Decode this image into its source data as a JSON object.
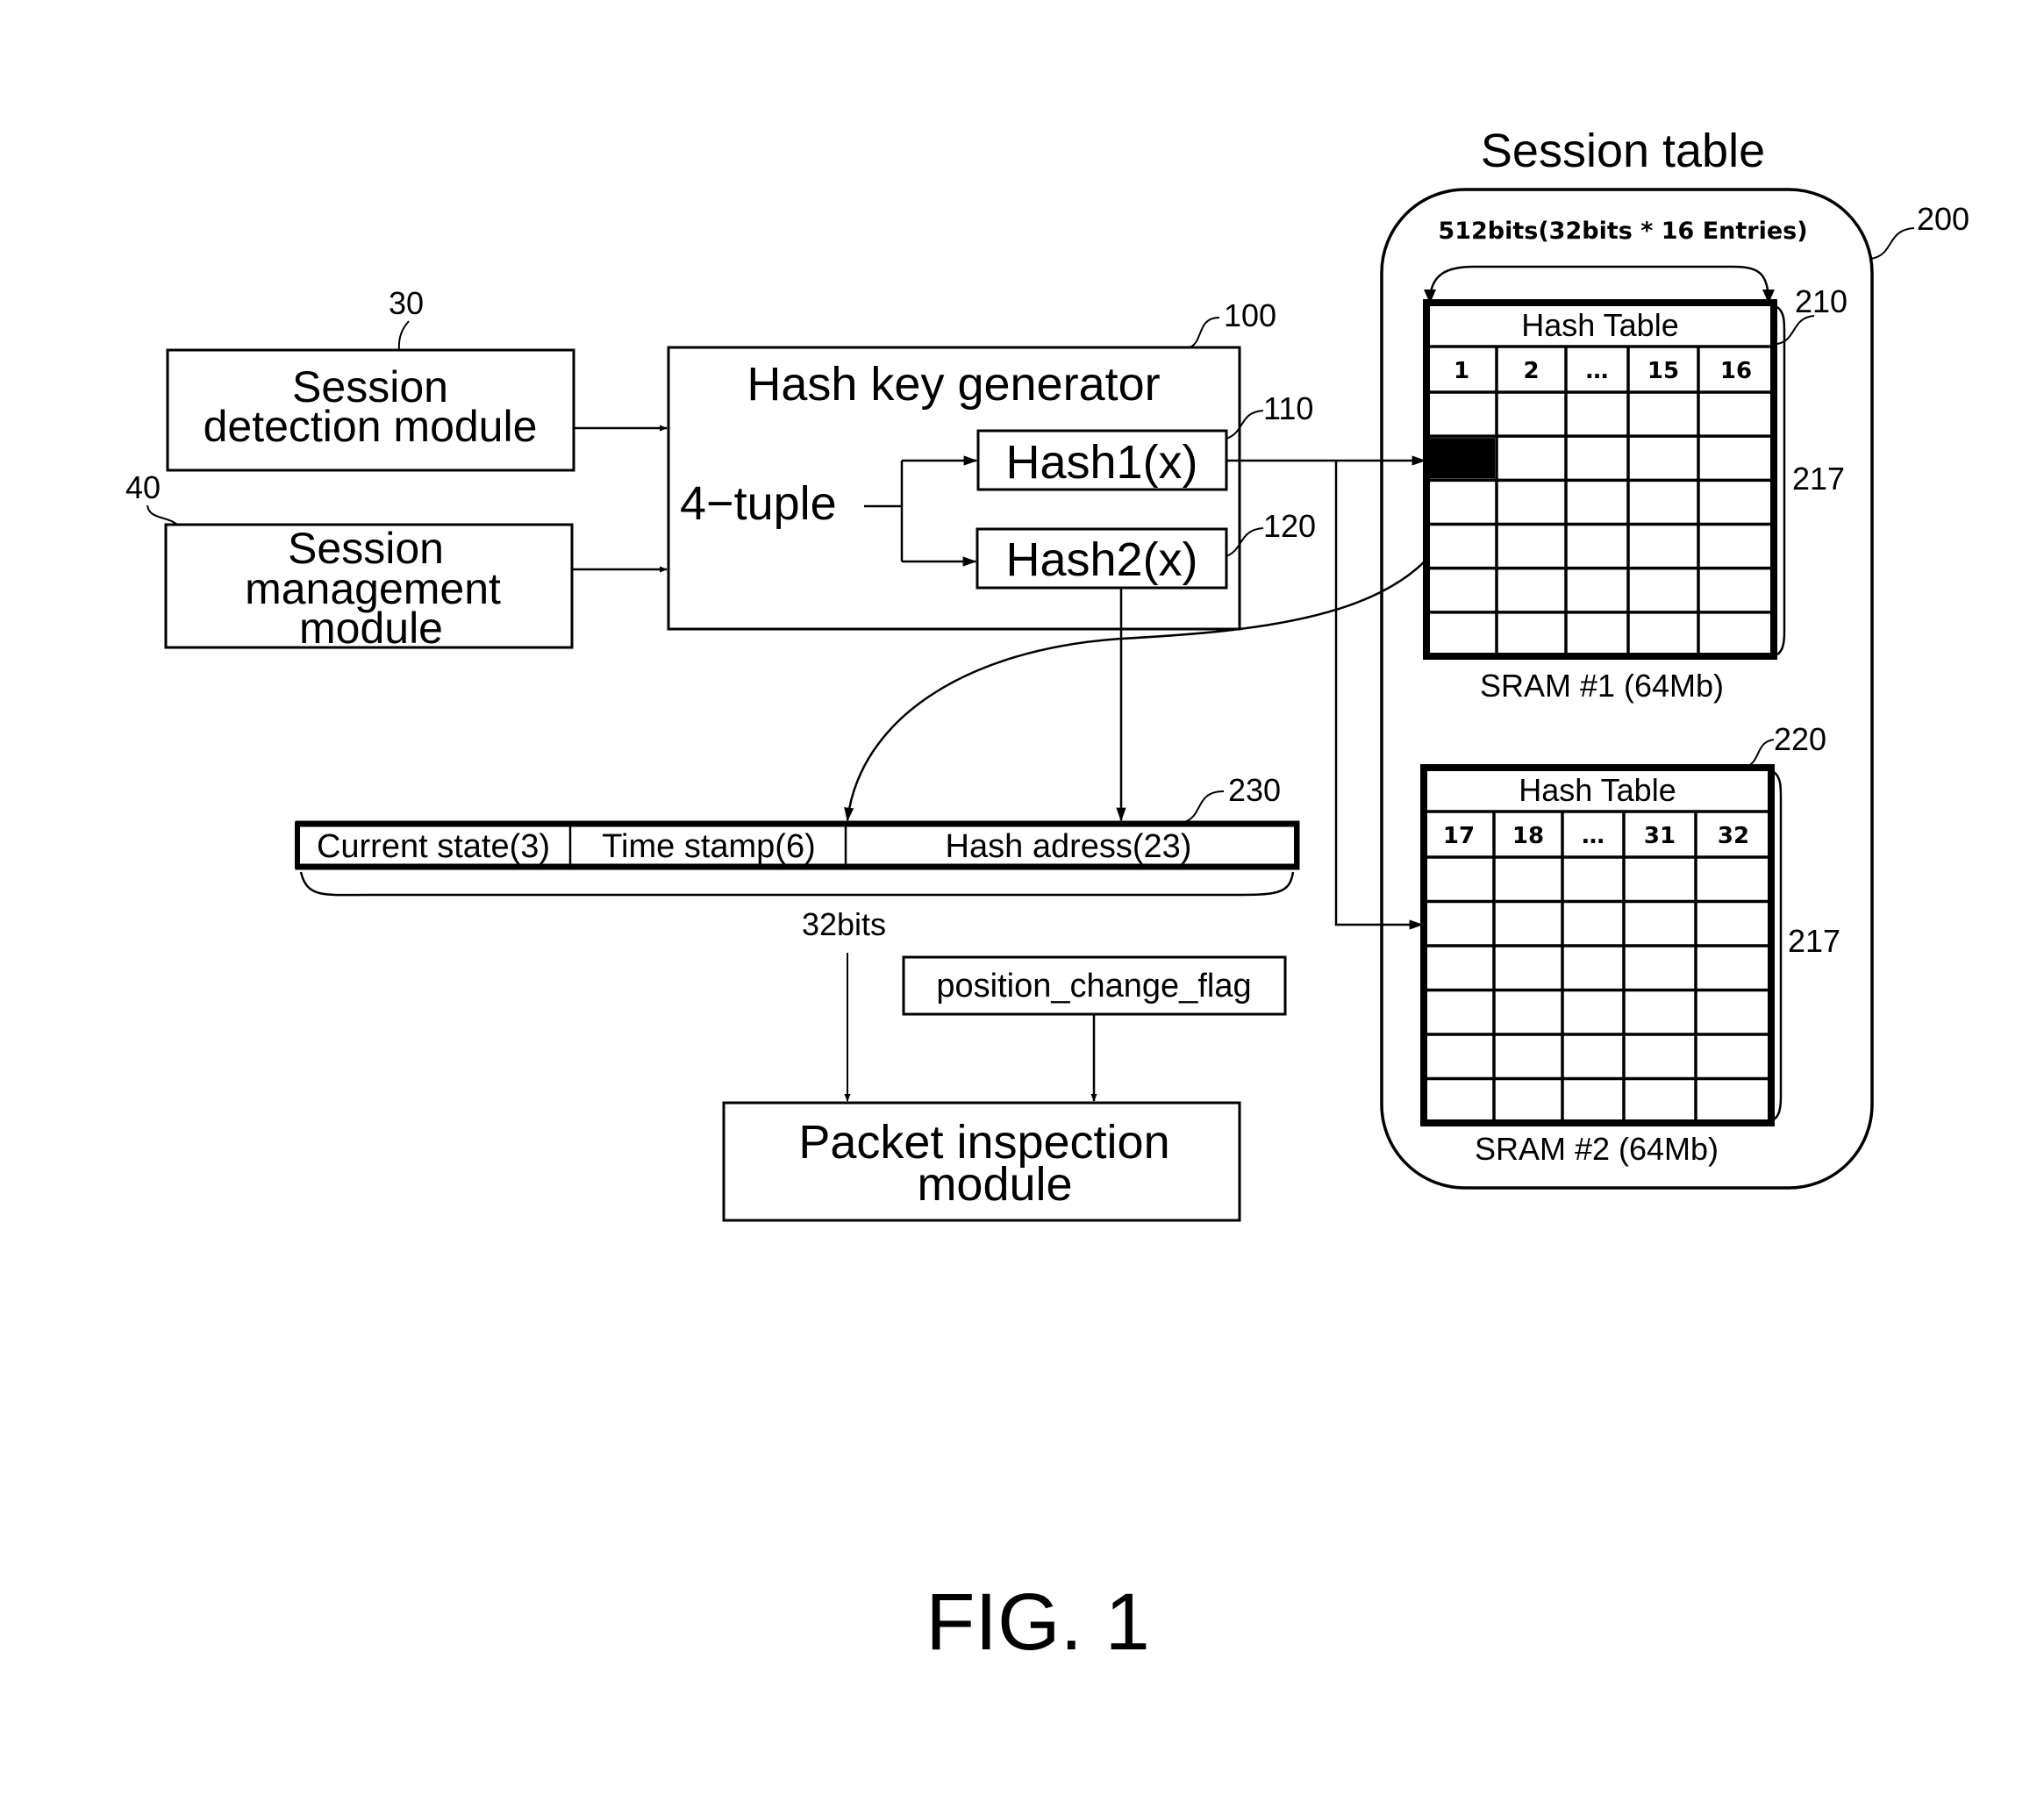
{
  "figure": {
    "caption": "FIG. 1"
  },
  "reference_numerals": {
    "session_detection": "30",
    "session_management": "40",
    "hash_key_generator": "100",
    "hash1": "110",
    "hash2": "120",
    "session_table": "200",
    "hash_table_1": "210",
    "hash_table_2": "220",
    "session_record": "230",
    "rows_table_1": "217",
    "rows_table_2": "217"
  },
  "modules": {
    "session_detection": [
      "Session",
      "detection module"
    ],
    "session_management": [
      "Session",
      "management",
      "module"
    ],
    "hash_key_generator": "Hash key generator",
    "four_tuple": "4−tuple",
    "hash1": "Hash1(x)",
    "hash2": "Hash2(x)",
    "packet_inspection": [
      "Packet inspection",
      "module"
    ],
    "position_change_flag": "position_change_flag"
  },
  "session_table": {
    "title": "Session table",
    "width_label": "512bits(32bits * 16 Entries)",
    "tables": [
      {
        "title": "Hash Table",
        "columns": [
          "1",
          "2",
          "...",
          "15",
          "16"
        ],
        "rows": 6,
        "highlighted_cell": {
          "row": 1,
          "col": 0
        },
        "caption": "SRAM #1 (64Mb)"
      },
      {
        "title": "Hash Table",
        "columns": [
          "17",
          "18",
          "...",
          "31",
          "32"
        ],
        "rows": 6,
        "caption": "SRAM #2 (64Mb)"
      }
    ]
  },
  "session_record": {
    "fields": [
      {
        "name": "Current state(3)",
        "bits": 3
      },
      {
        "name": "Time stamp(6)",
        "bits": 6
      },
      {
        "name": "Hash adress(23)",
        "bits": 23
      }
    ],
    "total_label": "32bits"
  }
}
